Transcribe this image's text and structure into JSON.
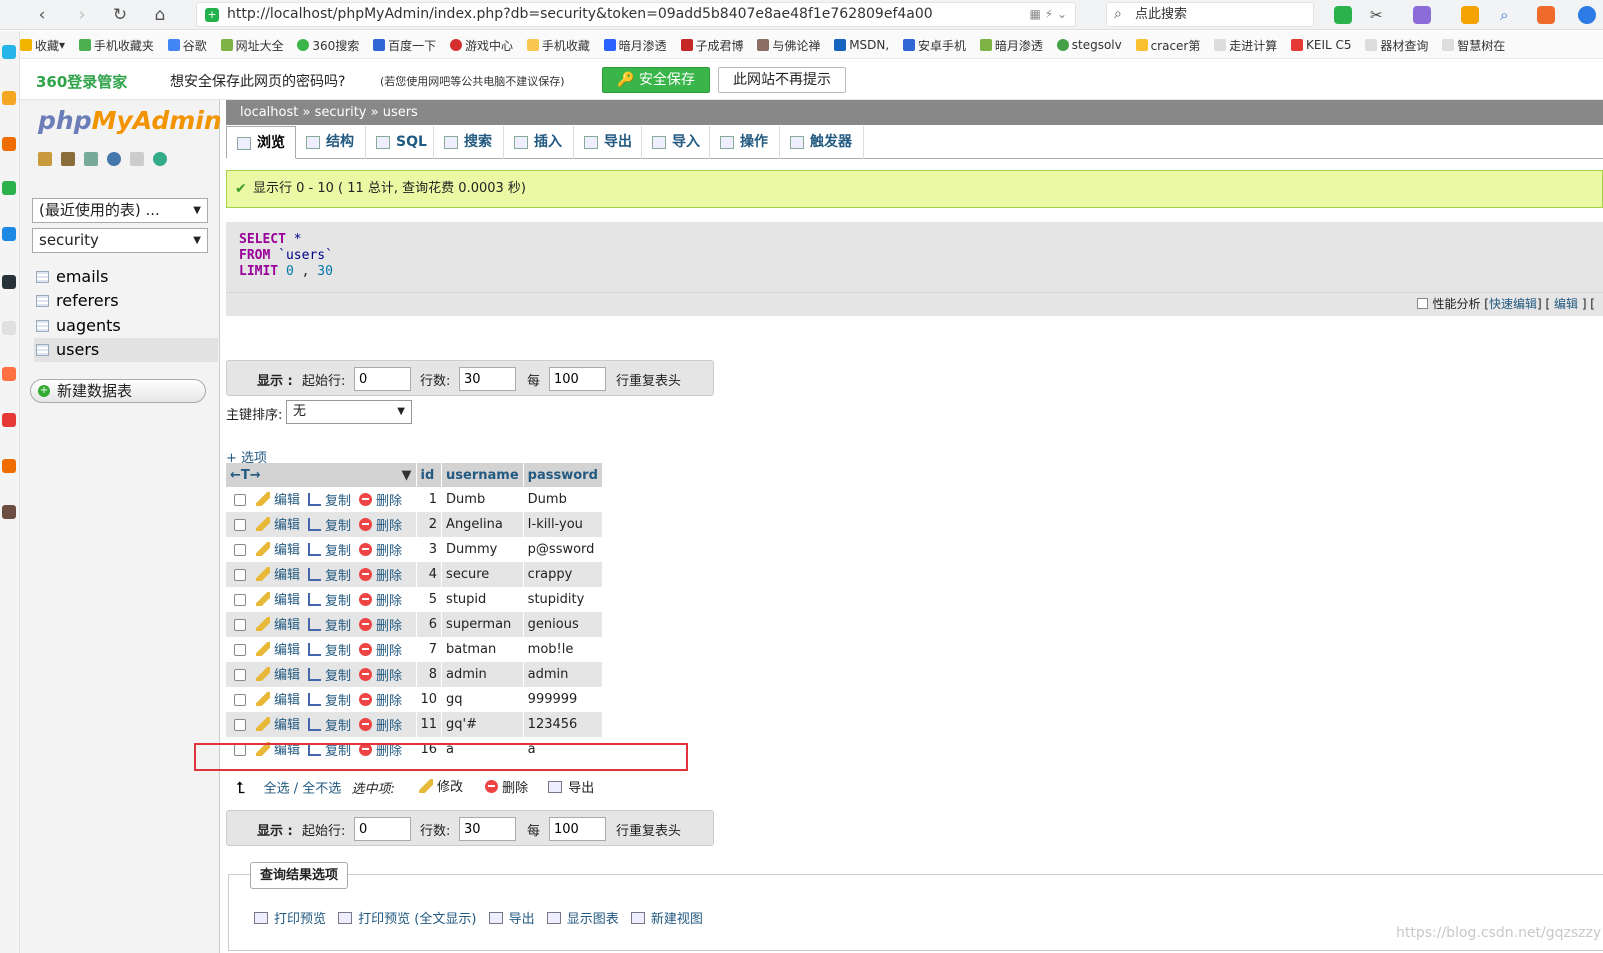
{
  "browser": {
    "url": "http://localhost/phpMyAdmin/index.php?db=security&token=09add5b8407e8ae48f1e762809ef4a00",
    "search_placeholder": "点此搜索",
    "bookmarks": [
      "收藏",
      "手机收藏夹",
      "谷歌",
      "网址大全",
      "360搜索",
      "百度一下",
      "游戏中心",
      "手机收藏",
      "暗月渗透",
      "子成君博",
      "与佛论禅",
      "MSDN,",
      "安卓手机",
      "暗月渗透",
      "stegsolv",
      "cracer第",
      "走进计算",
      "KEIL C5",
      "器材查询",
      "智慧树在"
    ],
    "pwd_bar": {
      "logo": "360登录管家",
      "message": "想安全保存此网页的密码吗?",
      "note": "(若您使用网吧等公共电脑不建议保存)",
      "save_label": "安全保存",
      "nomore_label": "此网站不再提示"
    }
  },
  "sidebar": {
    "logo_php": "php",
    "logo_my": "MyAdmin",
    "recent_label": "(最近使用的表) ...",
    "db_select": "security",
    "tables": [
      "emails",
      "referers",
      "uagents",
      "users"
    ],
    "new_table_label": "新建数据表"
  },
  "breadcrumb": {
    "server": "localhost",
    "db": "security",
    "table": "users"
  },
  "tabs": [
    "浏览",
    "结构",
    "SQL",
    "搜索",
    "插入",
    "导出",
    "导入",
    "操作",
    "触发器"
  ],
  "success_message": "显示行 0 - 10 ( 11 总计, 查询花费 0.0003 秒)",
  "sql": {
    "line1_kw": "SELECT",
    "line1_rest": " *",
    "line2_kw": "FROM",
    "line2_rest": " `users`",
    "line3_kw": "LIMIT",
    "line3_n1": " 0",
    "line3_sep": " ,",
    "line3_n2": " 30"
  },
  "sql_bar": {
    "profiling": "性能分析",
    "quick_edit": "快速编辑",
    "edit": "编辑",
    "tail": "] ["
  },
  "nav": {
    "show": "显示 :",
    "start_row_label": "起始行:",
    "start_row": "0",
    "rows_label": "行数:",
    "rows": "30",
    "per_label": "每",
    "per": "100",
    "repeat_header": "行重复表头"
  },
  "sort": {
    "label": "主键排序:",
    "value": "无"
  },
  "options_label": "+ 选项",
  "table": {
    "columns": [
      "id",
      "username",
      "password"
    ],
    "action_labels": {
      "edit": "编辑",
      "copy": "复制",
      "delete": "删除"
    },
    "rows": [
      {
        "id": "1",
        "username": "Dumb",
        "password": "Dumb"
      },
      {
        "id": "2",
        "username": "Angelina",
        "password": "I-kill-you"
      },
      {
        "id": "3",
        "username": "Dummy",
        "password": "p@ssword"
      },
      {
        "id": "4",
        "username": "secure",
        "password": "crappy"
      },
      {
        "id": "5",
        "username": "stupid",
        "password": "stupidity"
      },
      {
        "id": "6",
        "username": "superman",
        "password": "genious"
      },
      {
        "id": "7",
        "username": "batman",
        "password": "mob!le"
      },
      {
        "id": "8",
        "username": "admin",
        "password": "admin"
      },
      {
        "id": "10",
        "username": "gq",
        "password": "999999"
      },
      {
        "id": "11",
        "username": "gq'#",
        "password": "123456"
      },
      {
        "id": "16",
        "username": "a",
        "password": "a"
      }
    ]
  },
  "bulk": {
    "select_all": "全选",
    "sep": "/",
    "select_none": "全不选",
    "with_selected": "选中项:",
    "modify": "修改",
    "delete": "删除",
    "export": "导出"
  },
  "query_results": {
    "title": "查询结果选项",
    "actions": [
      "打印预览",
      "打印预览 (全文显示)",
      "导出",
      "显示图表",
      "新建视图"
    ]
  },
  "watermark": "https://blog.csdn.net/gqzszzy",
  "colors": {
    "link": "#235a81",
    "success_bg": "#ebf8a4",
    "highlight_border": "#e0333a"
  }
}
